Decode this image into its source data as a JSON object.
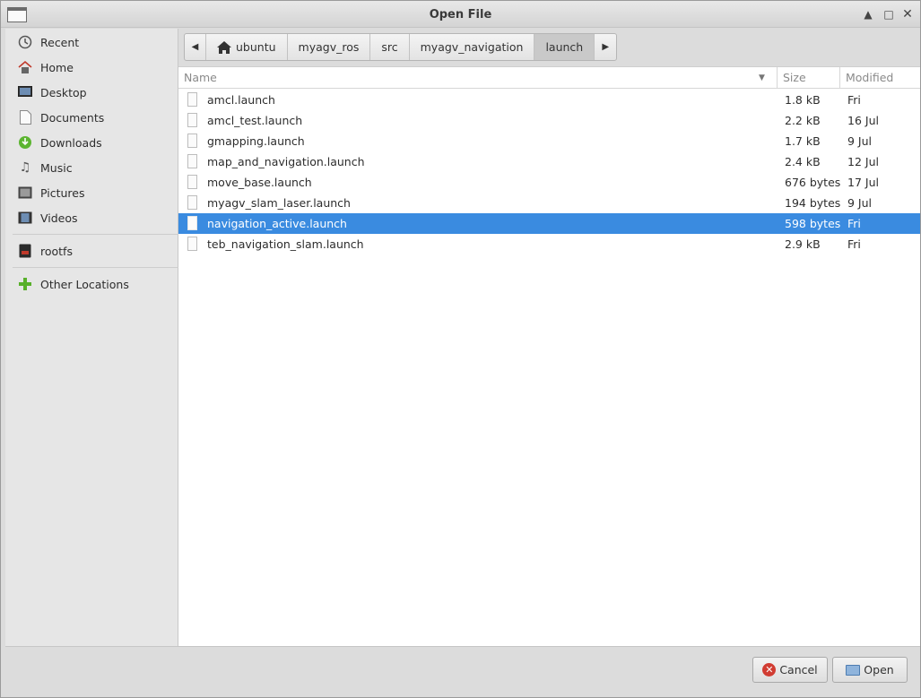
{
  "window": {
    "title": "Open File"
  },
  "sidebar": {
    "items": [
      {
        "label": "Recent",
        "icon": "clock-icon"
      },
      {
        "label": "Home",
        "icon": "home-icon"
      },
      {
        "label": "Desktop",
        "icon": "desktop-icon"
      },
      {
        "label": "Documents",
        "icon": "document-icon"
      },
      {
        "label": "Downloads",
        "icon": "download-icon"
      },
      {
        "label": "Music",
        "icon": "music-icon"
      },
      {
        "label": "Pictures",
        "icon": "pictures-icon"
      },
      {
        "label": "Videos",
        "icon": "video-icon"
      },
      {
        "label": "rootfs",
        "icon": "drive-icon"
      },
      {
        "label": "Other Locations",
        "icon": "plus-icon"
      }
    ]
  },
  "pathbar": {
    "crumbs": [
      "ubuntu",
      "myagv_ros",
      "src",
      "myagv_navigation",
      "launch"
    ],
    "active": "launch"
  },
  "columns": {
    "name": "Name",
    "size": "Size",
    "modified": "Modified"
  },
  "files": [
    {
      "name": "amcl.launch",
      "size": "1.8 kB",
      "modified": "Fri"
    },
    {
      "name": "amcl_test.launch",
      "size": "2.2 kB",
      "modified": "16 Jul"
    },
    {
      "name": "gmapping.launch",
      "size": "1.7 kB",
      "modified": "9 Jul"
    },
    {
      "name": "map_and_navigation.launch",
      "size": "2.4 kB",
      "modified": "12 Jul"
    },
    {
      "name": "move_base.launch",
      "size": "676 bytes",
      "modified": "17 Jul"
    },
    {
      "name": "myagv_slam_laser.launch",
      "size": "194 bytes",
      "modified": "9 Jul"
    },
    {
      "name": "navigation_active.launch",
      "size": "598 bytes",
      "modified": "Fri",
      "selected": true
    },
    {
      "name": "teb_navigation_slam.launch",
      "size": "2.9 kB",
      "modified": "Fri"
    }
  ],
  "footer": {
    "cancel_label": "Cancel",
    "open_label": "Open"
  },
  "colors": {
    "selection": "#3a8be0",
    "cancel_icon": "#d13c32",
    "downloads_icon": "#5cb531",
    "add_icon": "#58b02a"
  }
}
